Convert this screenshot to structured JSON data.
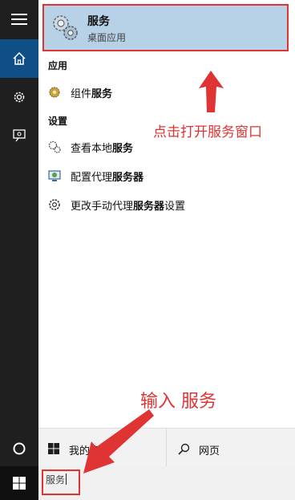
{
  "best_match": {
    "title": "服务",
    "subtitle": "桌面应用"
  },
  "sections": {
    "apps": "应用",
    "settings": "设置"
  },
  "app_items": [
    {
      "prefix": "组件",
      "bold": "服务",
      "suffix": "",
      "icon": "component-services-icon"
    }
  ],
  "settings_items": [
    {
      "prefix": "查看本地",
      "bold": "服务",
      "suffix": "",
      "icon": "local-services-icon"
    },
    {
      "prefix": "配置代理",
      "bold": "服务器",
      "suffix": "",
      "icon": "proxy-config-icon"
    },
    {
      "prefix": "更改手动代理",
      "bold": "服务器",
      "suffix": "设置",
      "icon": "gear-icon"
    }
  ],
  "bottom_tabs": {
    "my_stuff": "我的资料",
    "web": "网页"
  },
  "search": {
    "value": "服务"
  },
  "annotations": {
    "open_services": "点击打开服务窗口",
    "type_services": "输入 服务"
  },
  "colors": {
    "accent": "#0f4f86",
    "highlight": "#b7d1e6",
    "annotation": "#e03333",
    "rail": "#1f1f1f"
  }
}
